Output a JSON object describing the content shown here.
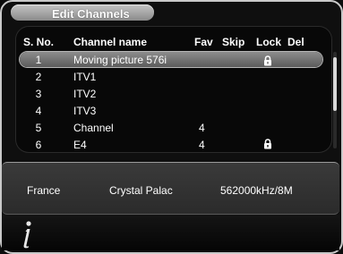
{
  "window": {
    "title": "Edit Channels"
  },
  "columns": {
    "sno": "S. No.",
    "name": "Channel name",
    "fav": "Fav",
    "skip": "Skip",
    "lock": "Lock",
    "del": "Del"
  },
  "rows": [
    {
      "num": "1",
      "name": "Moving picture 576i",
      "fav": "",
      "locked": true,
      "selected": true
    },
    {
      "num": "2",
      "name": "ITV1",
      "fav": "",
      "locked": false,
      "selected": false
    },
    {
      "num": "3",
      "name": "ITV2",
      "fav": "",
      "locked": false,
      "selected": false
    },
    {
      "num": "4",
      "name": "ITV3",
      "fav": "",
      "locked": false,
      "selected": false
    },
    {
      "num": "5",
      "name": "Channel",
      "fav": "4",
      "locked": false,
      "selected": false
    },
    {
      "num": "6",
      "name": "E4",
      "fav": "4",
      "locked": true,
      "selected": false
    }
  ],
  "info": {
    "country": "France",
    "transmitter": "Crystal Palac",
    "frequency": "562000kHz/8M"
  },
  "icons": {
    "lock": "lock-icon",
    "info": "info-icon"
  },
  "colors": {
    "highlight": "#6f6f6f",
    "background": "#0f0f0f"
  }
}
